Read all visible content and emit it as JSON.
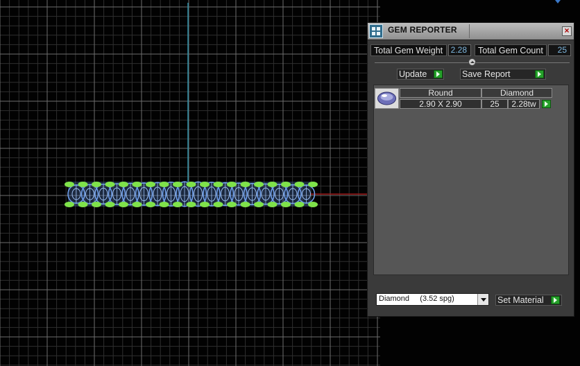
{
  "panel": {
    "title": "GEM REPORTER",
    "close_glyph": "×",
    "app_icon": "gem-reporter-icon"
  },
  "totals": {
    "weight_label": "Total Gem Weight",
    "weight_value": "2.28",
    "count_label": "Total Gem Count",
    "count_value": "25"
  },
  "buttons": {
    "update": "Update",
    "save_report": "Save Report",
    "set_material": "Set Material"
  },
  "gem_row": {
    "shape": "Round",
    "material": "Diamond",
    "size": "2.90 X 2.90",
    "count": "25",
    "weight": "2.28tw",
    "thumb_icon": "round-gem-icon"
  },
  "material_select": {
    "value": "Diamond     (3.52 spg)"
  },
  "colors": {
    "accent_value": "#7fb8e0",
    "play_green": "#25a02a",
    "grid": "#6e6e6e",
    "axis_vertical": "#2d8fa6",
    "axis_horizontal": "#a01818",
    "gem_wire": "#6f9ee8",
    "prong": "#7fe24a"
  }
}
